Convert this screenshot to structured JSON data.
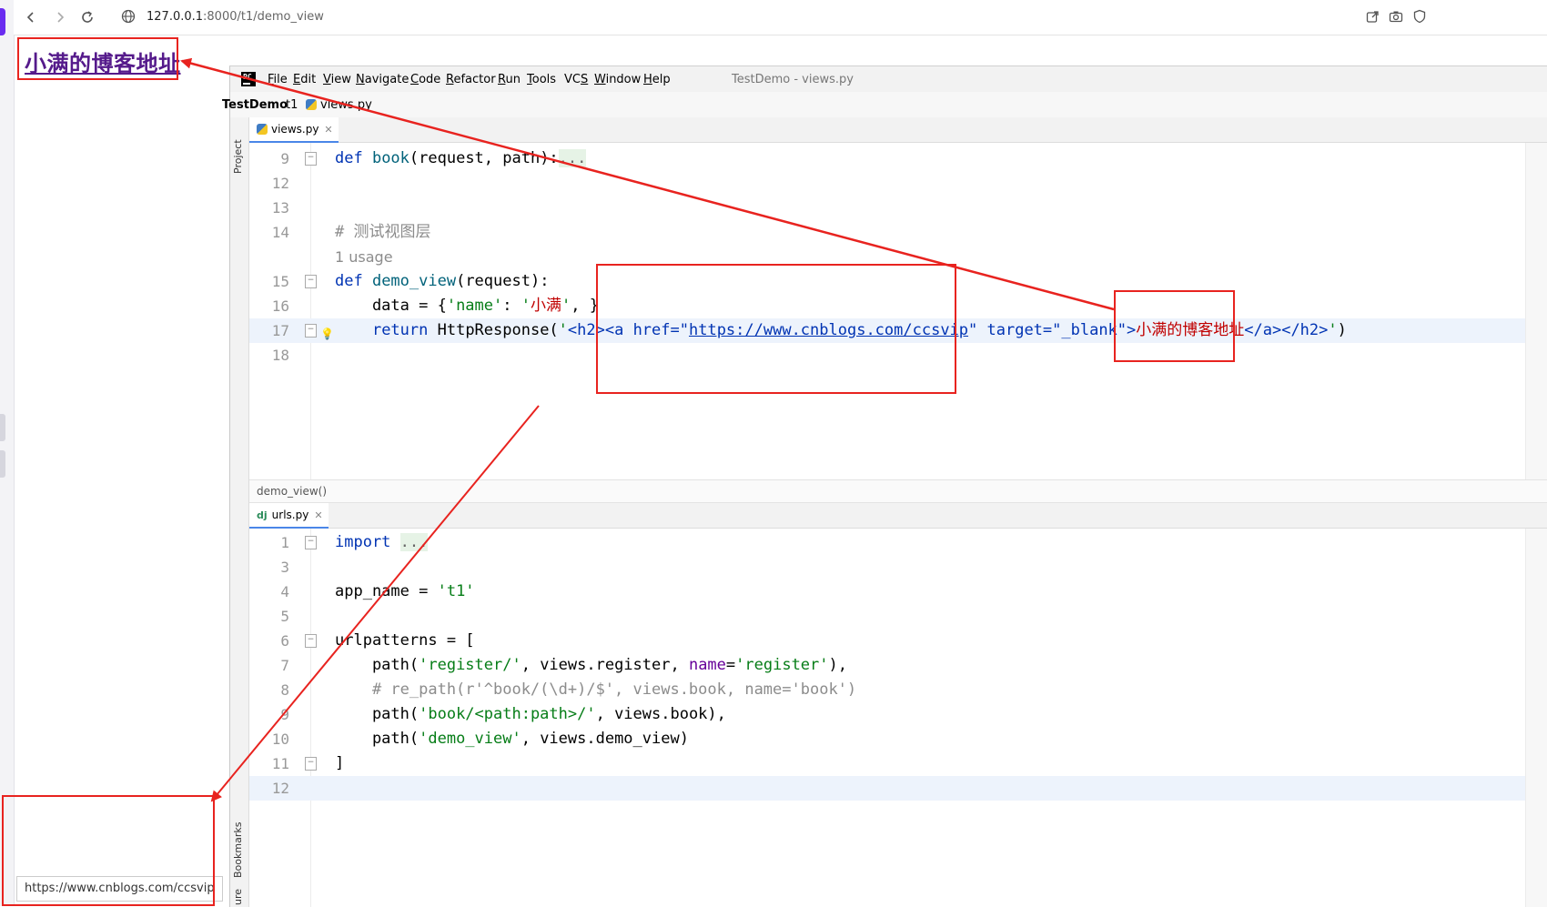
{
  "browser": {
    "address_host": "127.0.0.1",
    "address_rest": ":8000/t1/demo_view",
    "status_url": "https://www.cnblogs.com/ccsvip"
  },
  "page": {
    "link_text": "小满的博客地址"
  },
  "ide": {
    "menu": [
      "File",
      "Edit",
      "View",
      "Navigate",
      "Code",
      "Refactor",
      "Run",
      "Tools",
      "VCS",
      "Window",
      "Help"
    ],
    "menu_mnemonics": [
      "F",
      "E",
      "V",
      "N",
      "C",
      "R",
      "R",
      "T",
      "S",
      "W",
      "H"
    ],
    "window_title": "TestDemo - views.py",
    "breadcrumbs": {
      "project": "TestDemo",
      "module": "t1",
      "file": "views.py"
    },
    "side_labels": {
      "project": "Project",
      "bookmarks": "Bookmarks",
      "structure": "ure"
    },
    "top_editor": {
      "tab": "views.py",
      "lines": [
        {
          "num": "9",
          "parts": [
            [
              "kw",
              "def "
            ],
            [
              "fn",
              "book"
            ],
            [
              "",
              "(request, path):"
            ],
            [
              "fold-sum",
              "..."
            ]
          ],
          "fold": true
        },
        {
          "num": "12",
          "parts": []
        },
        {
          "num": "13",
          "parts": []
        },
        {
          "num": "14",
          "parts": [
            [
              "cmt",
              "# "
            ],
            [
              "cmt",
              "测试视图层"
            ]
          ]
        },
        {
          "num": "",
          "parts": [
            [
              "usage",
              "1 usage"
            ]
          ]
        },
        {
          "num": "15",
          "parts": [
            [
              "kw",
              "def "
            ],
            [
              "fn",
              "demo_view"
            ],
            [
              "",
              "(request):"
            ]
          ],
          "fold": true
        },
        {
          "num": "16",
          "parts": [
            [
              "",
              "    data = {"
            ],
            [
              "str",
              "'name'"
            ],
            [
              "",
              ": "
            ],
            [
              "str",
              "'"
            ],
            [
              "cjk-str",
              "小满"
            ],
            [
              "str",
              "'"
            ],
            [
              "",
              ", }"
            ]
          ]
        },
        {
          "num": "17",
          "parts": [
            [
              "",
              "    "
            ],
            [
              "kw",
              "return "
            ],
            [
              "",
              "HttpResponse("
            ],
            [
              "str",
              "'"
            ],
            [
              "html",
              "<h2><a href=\""
            ],
            [
              "url",
              "https://www.cnblogs.com/ccsvip"
            ],
            [
              "html",
              "\" target=\"_blank\">"
            ],
            [
              "cjk-str",
              "小满的博客地址"
            ],
            [
              "html",
              "</a></h2>"
            ],
            [
              "str",
              "'"
            ],
            [
              "",
              ")"
            ]
          ],
          "hl": true,
          "fold": true,
          "bulb": true
        },
        {
          "num": "18",
          "parts": []
        }
      ],
      "footer_crumb": "demo_view()"
    },
    "bottom_editor": {
      "tab": "urls.py",
      "lines": [
        {
          "num": "1",
          "parts": [
            [
              "kw",
              "import "
            ],
            [
              "fold-sum",
              "..."
            ]
          ],
          "fold": true
        },
        {
          "num": "3",
          "parts": []
        },
        {
          "num": "4",
          "parts": [
            [
              "",
              "app_name = "
            ],
            [
              "str",
              "'t1'"
            ]
          ]
        },
        {
          "num": "5",
          "parts": []
        },
        {
          "num": "6",
          "parts": [
            [
              "",
              "urlpatterns = ["
            ]
          ],
          "fold": true
        },
        {
          "num": "7",
          "parts": [
            [
              "",
              "    path("
            ],
            [
              "str",
              "'register/'"
            ],
            [
              "",
              ", views.register, "
            ],
            [
              "prm",
              "name"
            ],
            [
              "",
              "="
            ],
            [
              "str",
              "'register'"
            ],
            [
              "",
              "),"
            ]
          ]
        },
        {
          "num": "8",
          "parts": [
            [
              "cmt",
              "    # re_path(r'^book/(\\d+)/$', views.book, name='book')"
            ]
          ]
        },
        {
          "num": "9",
          "parts": [
            [
              "",
              "    path("
            ],
            [
              "str",
              "'book/<path:path>/'"
            ],
            [
              "",
              ", views.book),"
            ]
          ]
        },
        {
          "num": "10",
          "parts": [
            [
              "",
              "    path("
            ],
            [
              "str",
              "'demo_view'"
            ],
            [
              "",
              ", views.demo_view)"
            ]
          ]
        },
        {
          "num": "11",
          "parts": [
            [
              "",
              "]"
            ]
          ],
          "fold": true
        },
        {
          "num": "12",
          "parts": [],
          "hl": true
        }
      ]
    }
  },
  "colors": {
    "annotation_red": "#e8231f",
    "link_visited": "#551a8b",
    "keyword": "#0033b3",
    "string": "#067d17"
  }
}
